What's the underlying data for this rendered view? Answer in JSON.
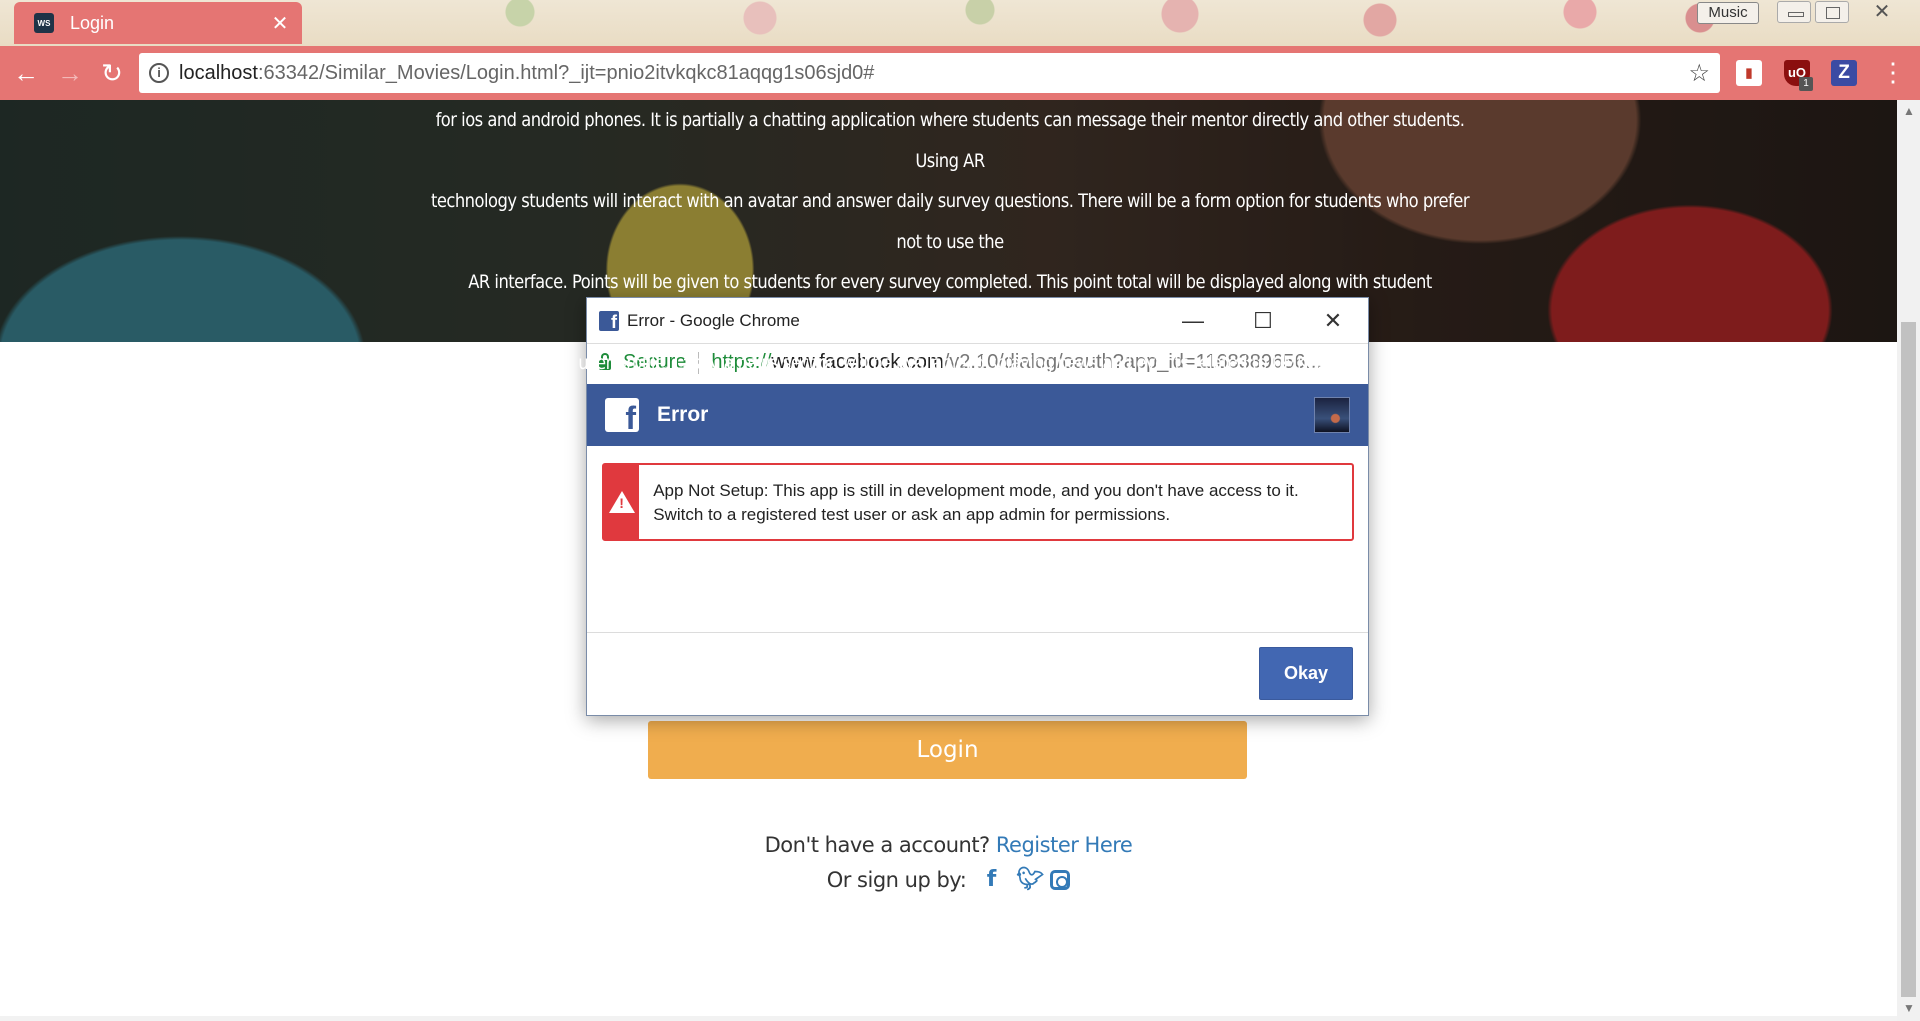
{
  "browser": {
    "tab_title": "Login",
    "tab_favicon_text": "WS",
    "music_label": "Music",
    "url_host": "localhost",
    "url_rest": ":63342/Similar_Movies/Login.html?_ijt=pnio2itvkqkc81aqqg1s06sjd0#",
    "ext_badge": "1",
    "ext_z": "Z",
    "ext_ub": "uO"
  },
  "hero": {
    "lines": [
      "for ios and android phones. It is partially a chatting application where students can message their mentor directly and other students. Using AR",
      "technology students will interact with an avatar and answer daily survey questions. There will be a form option for students who prefer not to use the",
      "AR interface. Points will be given to students for every survey completed. This point total will be displayed along with student achievements on their",
      "user profile. Lastly a news section will be available, displaying news and events related to UMKC."
    ]
  },
  "login": {
    "button_label": "Login",
    "register_prompt": "Don't have a account?",
    "register_link": "Register Here",
    "signup_prompt": "Or sign up by:"
  },
  "popup": {
    "window_title": "Error - Google Chrome",
    "secure_label": "Secure",
    "url_scheme": "https://",
    "url_host": "www.facebook.com",
    "url_path": "/v2.10/dialog/oauth?app_id=1168389656...",
    "header_title": "Error",
    "error_message": "App Not Setup: This app is still in development mode, and you don't have access to it. Switch to a registered test user or ask an app admin for permissions.",
    "okay_label": "Okay"
  },
  "colors": {
    "chrome_accent": "#e57573",
    "facebook_blue": "#3b5998",
    "error_red": "#e0393e",
    "login_orange": "#f0ad4e",
    "link_blue": "#337ab7"
  }
}
